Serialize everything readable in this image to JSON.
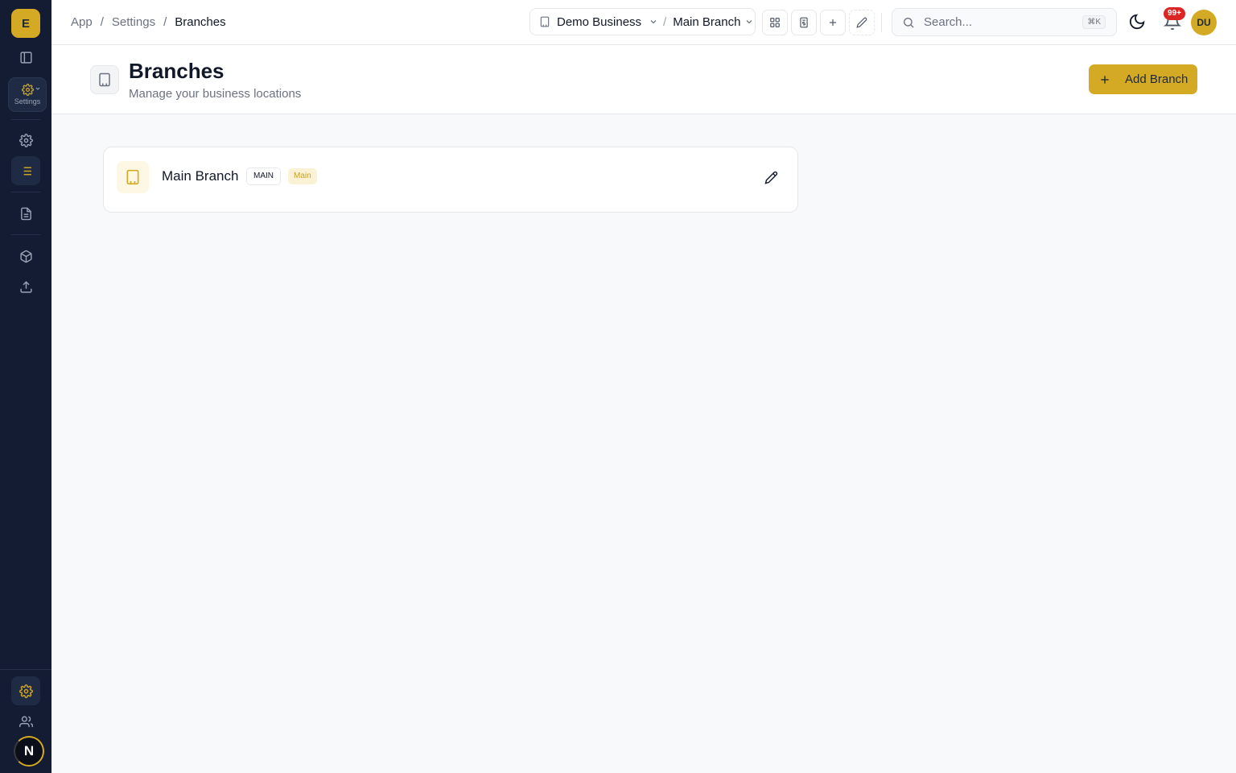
{
  "sidebar": {
    "logo_letter": "E",
    "module_label": "Settings",
    "user_initial": "N"
  },
  "topbar": {
    "breadcrumb": [
      "App",
      "/",
      "Settings",
      "/",
      "Branches"
    ],
    "business": "Demo Business",
    "separator": "/",
    "branch": "Main Branch",
    "search_placeholder": "Search...",
    "search_shortcut": "⌘K",
    "notification_count": "99+",
    "user_initials": "DU"
  },
  "page": {
    "title": "Branches",
    "subtitle": "Manage your business locations",
    "add_button_label": "Add Branch"
  },
  "branches": [
    {
      "name": "Main Branch",
      "code": "MAIN",
      "tag": "Main"
    }
  ],
  "colors": {
    "sidebar_bg": "#141c33",
    "accent": "#d4aa24",
    "notification_badge": "#dc2626"
  }
}
